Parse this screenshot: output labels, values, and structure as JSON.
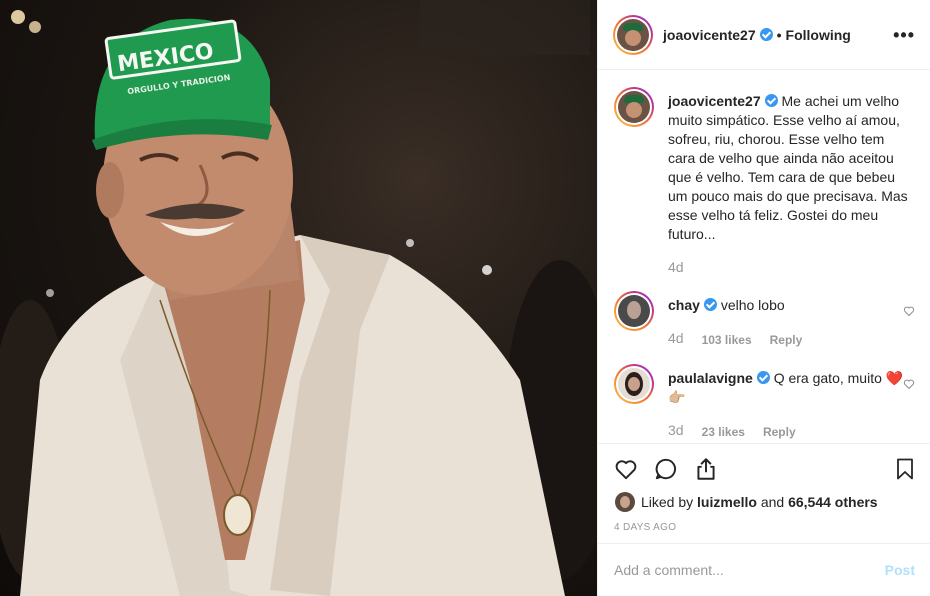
{
  "header": {
    "username": "joaovicente27",
    "separator": "•",
    "follow_status": "Following",
    "more": "•••"
  },
  "photo": {
    "cap_text_main": "MEXICO",
    "cap_text_sub": "ORGULLO Y TRADICION",
    "colors": {
      "cap": "#1f9a4f",
      "shirt": "#e9e1d6",
      "skin": "#b9856a"
    }
  },
  "caption": {
    "username": "joaovicente27",
    "text": "Me achei um velho muito simpático. Esse velho aí amou, sofreu, riu, chorou. Esse velho tem cara de velho que ainda não aceitou que é velho. Tem cara de que bebeu um pouco mais do que precisava. Mas esse velho tá feliz. Gostei do meu futuro...",
    "time": "4d"
  },
  "comments": [
    {
      "username": "chay",
      "text": "velho lobo",
      "time": "4d",
      "likes": "103 likes",
      "reply": "Reply"
    },
    {
      "username": "paulalavigne",
      "text": "Q era gato, muito ❤️👉🏼",
      "time": "3d",
      "likes": "23 likes",
      "reply": "Reply"
    }
  ],
  "likes_line": {
    "prefix": "Liked by",
    "user": "luizmello",
    "and": "and",
    "count": "66,544 others"
  },
  "posted_ago": "4 DAYS AGO",
  "add_comment": {
    "placeholder": "Add a comment...",
    "post_label": "Post"
  },
  "colors": {
    "verified": "#3897f0",
    "muted": "#999999",
    "post_disabled": "#b2dffc"
  }
}
